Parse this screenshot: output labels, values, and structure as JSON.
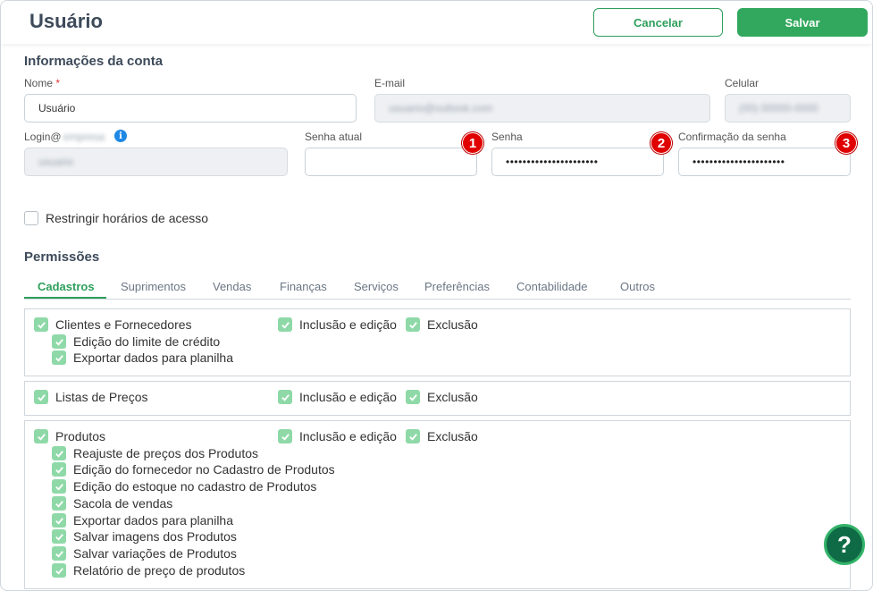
{
  "header": {
    "title": "Usuário",
    "cancel_label": "Cancelar",
    "save_label": "Salvar"
  },
  "account": {
    "section_title": "Informações da conta",
    "name_label": "Nome",
    "name_required": "*",
    "name_value": "Usuário",
    "email_label": "E-mail",
    "email_value": "usuario@outlook.com",
    "phone_label": "Celular",
    "phone_value": "(00) 00000-0000",
    "login_label": "Login@",
    "login_domain": "empresa",
    "login_value": "usuario",
    "current_password_label": "Senha atual",
    "current_password_value": "",
    "password_label": "Senha",
    "password_value": "••••••••••••••••••••••",
    "confirm_password_label": "Confirmação da senha",
    "confirm_password_value": "••••••••••••••••••••••",
    "badges": [
      "1",
      "2",
      "3"
    ],
    "restrict_label": "Restringir horários de acesso"
  },
  "permissions": {
    "section_title": "Permissões",
    "tabs": [
      "Cadastros",
      "Suprimentos",
      "Vendas",
      "Finanças",
      "Serviços",
      "Preferências",
      "Contabilidade",
      "Outros"
    ],
    "active_tab": "Cadastros",
    "groups": [
      {
        "label": "Clientes e Fornecedores",
        "include_edit": "Inclusão e edição",
        "delete": "Exclusão",
        "children": [
          "Edição do limite de crédito",
          "Exportar dados para planilha"
        ]
      },
      {
        "label": "Listas de Preços",
        "include_edit": "Inclusão e edição",
        "delete": "Exclusão",
        "children": []
      },
      {
        "label": "Produtos",
        "include_edit": "Inclusão e edição",
        "delete": "Exclusão",
        "children": [
          "Reajuste de preços dos Produtos",
          "Edição do fornecedor no Cadastro de Produtos",
          "Edição do estoque no cadastro de Produtos",
          "Sacola de vendas",
          "Exportar dados para planilha",
          "Salvar imagens dos Produtos",
          "Salvar variações de Produtos",
          "Relatório de preço de produtos"
        ]
      }
    ]
  },
  "help": {
    "icon": "question-icon",
    "label": "?"
  },
  "colors": {
    "accent": "#31a85d",
    "checkbox": "#8fd9a8",
    "badge": "#e00000",
    "help": "#0f6b45"
  }
}
